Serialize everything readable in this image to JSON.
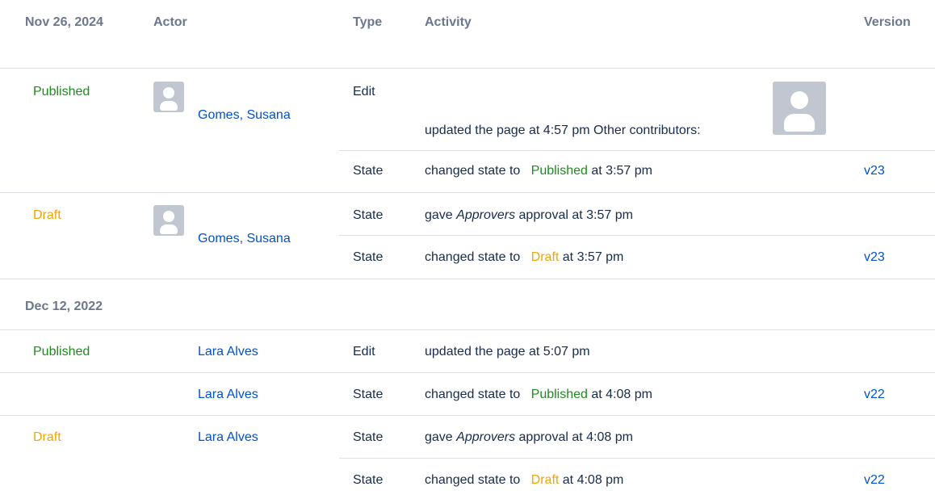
{
  "header": {
    "date": "Nov 26, 2024",
    "actor": "Actor",
    "type": "Type",
    "activity": "Activity",
    "version": "Version"
  },
  "groups": [
    {
      "date": "",
      "rows": [
        {
          "state": "Published",
          "actor": "Gomes, Susana",
          "type": "Edit",
          "activity_text": "updated the page at 4:57 pm Other contributors:",
          "version": ""
        },
        {
          "state": "",
          "actor": "",
          "type": "State",
          "activity_prefix": "changed state to",
          "activity_state": "Published",
          "activity_suffix": "at 3:57 pm",
          "version": "v23"
        },
        {
          "state": "Draft",
          "actor": "Gomes, Susana",
          "type": "State",
          "activity_prefix": "gave",
          "activity_emph": "Approvers",
          "activity_suffix": "approval at 3:57 pm",
          "version": ""
        },
        {
          "state": "",
          "actor": "",
          "type": "State",
          "activity_prefix": "changed state to",
          "activity_state": "Draft",
          "activity_suffix": "at 3:57 pm",
          "version": "v23"
        }
      ]
    },
    {
      "date": "Dec 12, 2022",
      "rows": [
        {
          "state": "Published",
          "actor": "Lara Alves",
          "type": "Edit",
          "activity_text": "updated the page at 5:07 pm",
          "version": ""
        },
        {
          "state": "",
          "actor": "Lara Alves",
          "type": "State",
          "activity_prefix": "changed state to",
          "activity_state": "Published",
          "activity_suffix": "at 4:08 pm",
          "version": "v22"
        },
        {
          "state": "Draft",
          "actor": "Lara Alves",
          "type": "State",
          "activity_prefix": "gave",
          "activity_emph": "Approvers",
          "activity_suffix": "approval at 4:08 pm",
          "version": ""
        },
        {
          "state": "",
          "actor": "",
          "type": "State",
          "activity_prefix": "changed state to",
          "activity_state": "Draft",
          "activity_suffix": "at 4:08 pm",
          "version": "v22"
        }
      ]
    }
  ],
  "colors": {
    "published": "#1f8a1f",
    "draft": "#f0a500",
    "link": "#0052cc",
    "header_text": "#6b778c",
    "divider": "#dfe1e6"
  },
  "icons": {
    "avatar": "user-avatar-icon"
  }
}
